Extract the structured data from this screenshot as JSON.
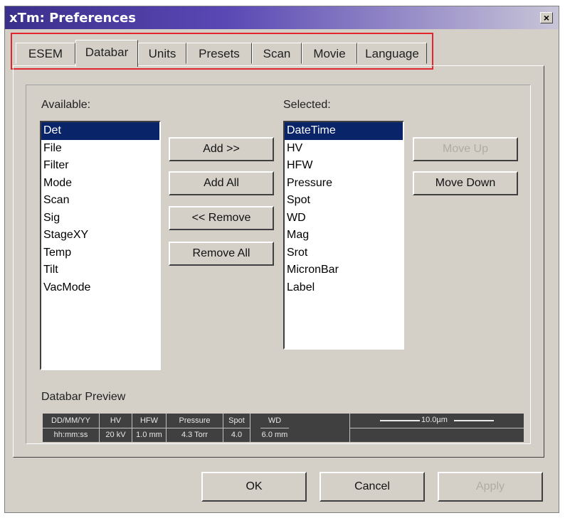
{
  "window": {
    "title": "xTm: Preferences",
    "close_label": "×"
  },
  "tabs": [
    {
      "label": "ESEM"
    },
    {
      "label": "Databar"
    },
    {
      "label": "Units"
    },
    {
      "label": "Presets"
    },
    {
      "label": "Scan"
    },
    {
      "label": "Movie"
    },
    {
      "label": "Language"
    }
  ],
  "available": {
    "label": "Available:",
    "items": [
      "Det",
      "File",
      "Filter",
      "Mode",
      "Scan",
      "Sig",
      "StageXY",
      "Temp",
      "Tilt",
      "VacMode"
    ],
    "selected_index": 0
  },
  "selected": {
    "label": "Selected:",
    "items": [
      "DateTime",
      "HV",
      "HFW",
      "Pressure",
      "Spot",
      "WD",
      "Mag",
      "Srot",
      "MicronBar",
      "Label"
    ],
    "selected_index": 0
  },
  "buttons": {
    "add": "Add >>",
    "add_all": "Add All",
    "remove": "<< Remove",
    "remove_all": "Remove All",
    "move_up": "Move Up",
    "move_down": "Move Down"
  },
  "preview": {
    "label": "Databar Preview",
    "cells": [
      {
        "top": "DD/MM/YY",
        "bottom": "hh:mm:ss"
      },
      {
        "top": "HV",
        "bottom": "20 kV"
      },
      {
        "top": "HFW",
        "bottom": "1.0 mm"
      },
      {
        "top": "Pressure",
        "bottom": "4.3 Torr"
      },
      {
        "top": "Spot",
        "bottom": "4.0"
      },
      {
        "top": "WD",
        "bottom": "6.0 mm"
      }
    ],
    "scale_label": "10.0µm"
  },
  "footer": {
    "ok": "OK",
    "cancel": "Cancel",
    "apply": "Apply"
  },
  "colors": {
    "selection": "#0a246a",
    "tab_highlight": "#e3262d",
    "face": "#d4d0c8"
  }
}
